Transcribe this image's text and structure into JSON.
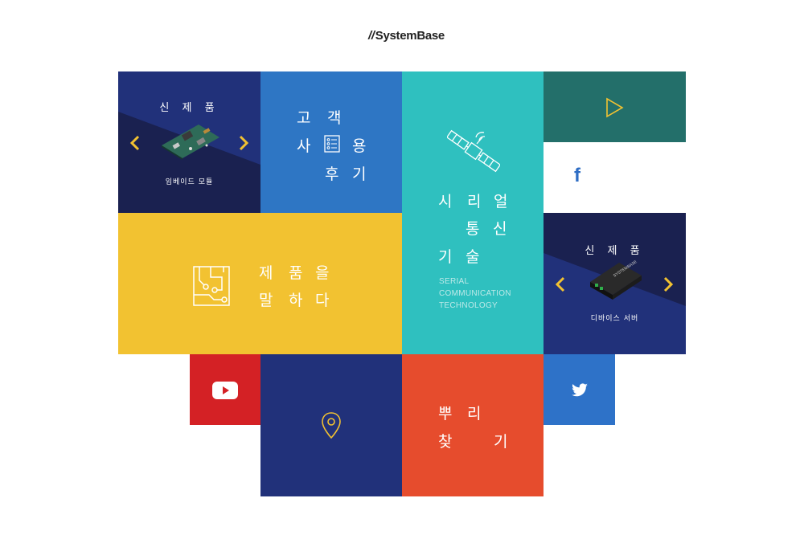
{
  "logo": {
    "mark": "//",
    "text": "SystemBase"
  },
  "tiles": {
    "embedded": {
      "title": "신 제 품",
      "caption": "임베이드 모듈"
    },
    "review": {
      "line1a": "고",
      "line1b": "객",
      "line2a": "사",
      "line2b": "용",
      "line3a": "후",
      "line3b": "기"
    },
    "serial": {
      "line1a": "시",
      "line1b": "리",
      "line1c": "얼",
      "line2a": "통",
      "line2b": "신",
      "line3a": "기",
      "line3b": "술",
      "sub1": "SERIAL",
      "sub2": "COMMUNICATION",
      "sub3": "TECHNOLOGY"
    },
    "talk": {
      "line1a": "제",
      "line1b": "품",
      "line1c": "을",
      "line2a": "말",
      "line2b": "하",
      "line2c": "다"
    },
    "device": {
      "title": "신 제 품",
      "caption": "디바이스 서버"
    },
    "roots": {
      "line1a": "뿌",
      "line1b": "리",
      "line2a": "찾",
      "line2b": "기"
    },
    "facebook": {
      "glyph": "f"
    }
  },
  "colors": {
    "navy": "#21317a",
    "darknavy": "#1a2150",
    "blue": "#2e76c4",
    "teal": "#2fc0bf",
    "darkteal": "#236f6a",
    "yellow": "#f2c231",
    "red": "#d42125",
    "orange": "#e64c2d",
    "twitter": "#2e72c8"
  }
}
